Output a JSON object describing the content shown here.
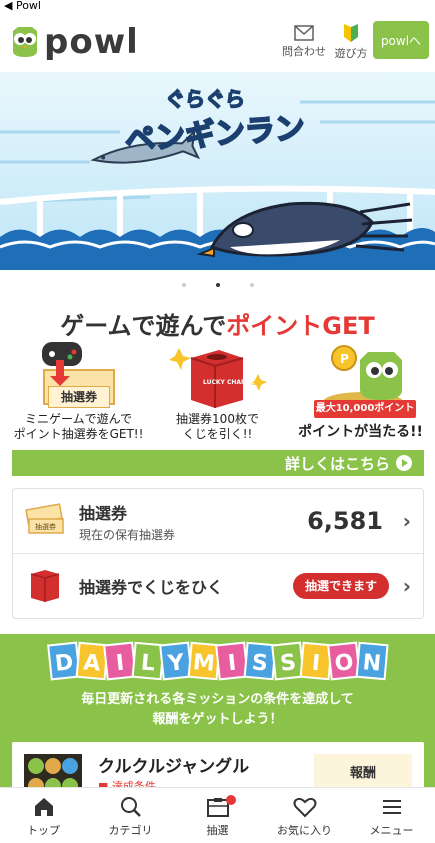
{
  "status_bar": {
    "back_label": "◀ Powl"
  },
  "header": {
    "logo_text": "powl",
    "contact_label": "問合わせ",
    "howto_label": "遊び方",
    "powl_button": "powlへ"
  },
  "banner": {
    "title_line1": "ぐらぐら",
    "title_line2": "ペンギンラン"
  },
  "carousel": {
    "total": 3,
    "active": 2
  },
  "game_section": {
    "title_prefix": "ゲームで遊んで",
    "title_highlight": "ポイントGET",
    "features": [
      {
        "tag": "抽選券",
        "line1": "ミニゲームで遊んで",
        "line2": "ポイント抽選券をGET!!"
      },
      {
        "tag": "LUCKY CHANCE",
        "line1": "抽選券100枚で",
        "line2": "くじを引く!!"
      },
      {
        "tag": "最大10,000ポイント",
        "line1": "ポイントが当たる!!",
        "line2": ""
      }
    ],
    "detail_link": "詳しくはこちら"
  },
  "tickets": {
    "ticket_icon_text": "抽選券",
    "title": "抽選券",
    "subtitle": "現在の保有抽選券",
    "count": "6,581",
    "draw_icon_text": "LUCKY CHANCE",
    "draw_label": "抽選券でくじをひく",
    "draw_button": "抽選できます"
  },
  "daily_mission": {
    "title_letters": [
      "D",
      "A",
      "I",
      "L",
      "Y",
      "M",
      "I",
      "S",
      "S",
      "I",
      "O",
      "N"
    ],
    "subtitle_line1": "毎日更新される各ミッションの条件を達成して",
    "subtitle_line2": "報酬をゲットしよう！",
    "item_title": "クルクルジャングル",
    "item_condition": "達成条件",
    "reward_label": "報酬"
  },
  "tabbar": {
    "items": [
      "トップ",
      "カテゴリ",
      "抽選",
      "お気に入り",
      "メニュー"
    ]
  },
  "colors": {
    "brand_green": "#8bc34a",
    "accent_red": "#e53935"
  }
}
